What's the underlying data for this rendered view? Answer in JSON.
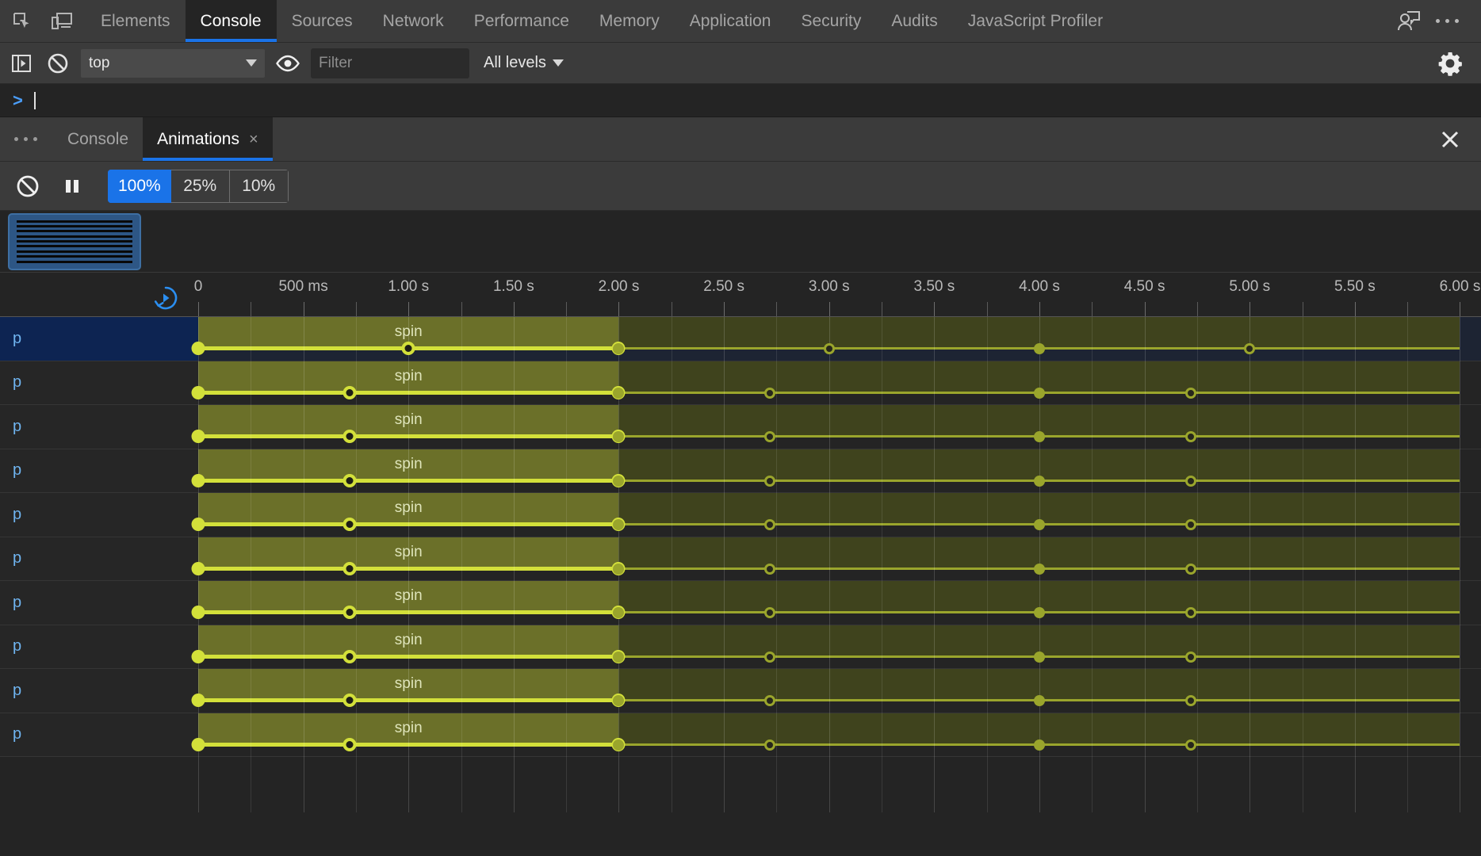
{
  "main_tabs": [
    {
      "label": "Elements",
      "active": false
    },
    {
      "label": "Console",
      "active": true
    },
    {
      "label": "Sources",
      "active": false
    },
    {
      "label": "Network",
      "active": false
    },
    {
      "label": "Performance",
      "active": false
    },
    {
      "label": "Memory",
      "active": false
    },
    {
      "label": "Application",
      "active": false
    },
    {
      "label": "Security",
      "active": false
    },
    {
      "label": "Audits",
      "active": false
    },
    {
      "label": "JavaScript Profiler",
      "active": false
    }
  ],
  "toolbar_icons": {
    "inspect": "inspect-element-icon",
    "device": "device-toolbar-icon",
    "feedback": "feedback-person-icon",
    "more": "more-options-icon",
    "settings": "settings-gear-icon"
  },
  "console_toolbar": {
    "sidebar_toggle": "console-sidebar-icon",
    "clear": "clear-console-icon",
    "context_value": "top",
    "eye": "live-expression-icon",
    "filter_placeholder": "Filter",
    "filter_value": "",
    "levels_label": "All levels"
  },
  "console_prompt": {
    "arrow": ">",
    "value": ""
  },
  "drawer": {
    "more_label": "more-tabs",
    "tabs": [
      {
        "label": "Console",
        "active": false,
        "closable": false
      },
      {
        "label": "Animations",
        "active": true,
        "closable": true,
        "close_glyph": "×"
      }
    ],
    "close_glyph": "✕"
  },
  "animations_toolbar": {
    "clear_icon": "clear-animations-icon",
    "pause_icon": "pause-animations-icon",
    "speeds": [
      {
        "label": "100%",
        "active": true
      },
      {
        "label": "25%",
        "active": false
      },
      {
        "label": "10%",
        "active": false
      }
    ]
  },
  "preview": {
    "cards": [
      {
        "name": "animation-group-preview-1",
        "selected": true,
        "stripe_count": 9
      }
    ]
  },
  "timeline": {
    "replay_icon": "replay-animation-icon",
    "ticks": [
      {
        "label": "0",
        "t": 0
      },
      {
        "label": "500 ms",
        "t": 0.5
      },
      {
        "label": "1.00 s",
        "t": 1.0
      },
      {
        "label": "1.50 s",
        "t": 1.5
      },
      {
        "label": "2.00 s",
        "t": 2.0
      },
      {
        "label": "2.50 s",
        "t": 2.5
      },
      {
        "label": "3.00 s",
        "t": 3.0
      },
      {
        "label": "3.50 s",
        "t": 3.5
      },
      {
        "label": "4.00 s",
        "t": 4.0
      },
      {
        "label": "4.50 s",
        "t": 4.5
      },
      {
        "label": "5.00 s",
        "t": 5.0
      },
      {
        "label": "5.50 s",
        "t": 5.5
      },
      {
        "label": "6.00 s",
        "t": 6.0
      }
    ],
    "range_start": 0,
    "range_end": 6.1
  },
  "colors": {
    "accent": "#1a73e8",
    "animation_bar": "#6b7029",
    "animation_bar_dim": "#3f431d",
    "keyframe": "#d3e03a",
    "selected_row": "#0d2452",
    "node_label": "#6fb4f0",
    "panel_bg": "#242424",
    "toolbar_bg": "#3b3b3b"
  },
  "rows": [
    {
      "node": "p",
      "name": "spin",
      "selected": true,
      "start": 0.0,
      "duration": 2.0,
      "iterations": 3,
      "keyframes": [
        0.0,
        1.0,
        2.0
      ],
      "label_t": 1.0
    },
    {
      "node": "p",
      "name": "spin",
      "selected": false,
      "start": 0.0,
      "duration": 2.0,
      "iterations": 3,
      "keyframes": [
        0.0,
        0.72,
        2.0
      ],
      "label_t": 1.0
    },
    {
      "node": "p",
      "name": "spin",
      "selected": false,
      "start": 0.0,
      "duration": 2.0,
      "iterations": 3,
      "keyframes": [
        0.0,
        0.72,
        2.0
      ],
      "label_t": 1.0
    },
    {
      "node": "p",
      "name": "spin",
      "selected": false,
      "start": 0.0,
      "duration": 2.0,
      "iterations": 3,
      "keyframes": [
        0.0,
        0.72,
        2.0
      ],
      "label_t": 1.0
    },
    {
      "node": "p",
      "name": "spin",
      "selected": false,
      "start": 0.0,
      "duration": 2.0,
      "iterations": 3,
      "keyframes": [
        0.0,
        0.72,
        2.0
      ],
      "label_t": 1.0
    },
    {
      "node": "p",
      "name": "spin",
      "selected": false,
      "start": 0.0,
      "duration": 2.0,
      "iterations": 3,
      "keyframes": [
        0.0,
        0.72,
        2.0
      ],
      "label_t": 1.0
    },
    {
      "node": "p",
      "name": "spin",
      "selected": false,
      "start": 0.0,
      "duration": 2.0,
      "iterations": 3,
      "keyframes": [
        0.0,
        0.72,
        2.0
      ],
      "label_t": 1.0
    },
    {
      "node": "p",
      "name": "spin",
      "selected": false,
      "start": 0.0,
      "duration": 2.0,
      "iterations": 3,
      "keyframes": [
        0.0,
        0.72,
        2.0
      ],
      "label_t": 1.0
    },
    {
      "node": "p",
      "name": "spin",
      "selected": false,
      "start": 0.0,
      "duration": 2.0,
      "iterations": 3,
      "keyframes": [
        0.0,
        0.72,
        2.0
      ],
      "label_t": 1.0
    },
    {
      "node": "p",
      "name": "spin",
      "selected": false,
      "start": 0.0,
      "duration": 2.0,
      "iterations": 3,
      "keyframes": [
        0.0,
        0.72,
        2.0
      ],
      "label_t": 1.0
    }
  ]
}
